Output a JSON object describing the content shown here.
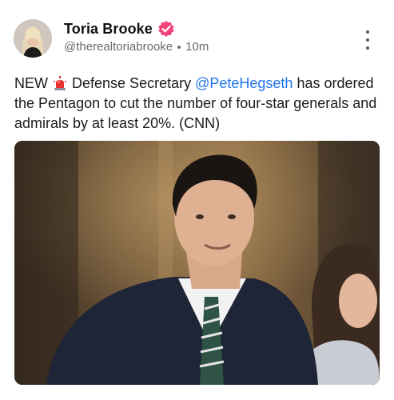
{
  "author": {
    "display_name": "Toria Brooke",
    "handle": "@therealtoriabrooke",
    "time_ago": "10m",
    "verified_icon": "verified-badge-icon",
    "badge_color": "#f0447a"
  },
  "post": {
    "text_before": "NEW",
    "siren_emoji": "🚨",
    "text_middle": " Defense Secretary ",
    "mention": "@PeteHegseth",
    "text_after": " has ordered the Pentagon to cut the number of four-star generals and admirals by at least 20%. (CNN)"
  },
  "media": {
    "type": "photo"
  },
  "menu": {
    "icon": "more-vertical-icon"
  },
  "colors": {
    "mention": "#1d73e8",
    "muted_text": "#6b6b6b"
  }
}
